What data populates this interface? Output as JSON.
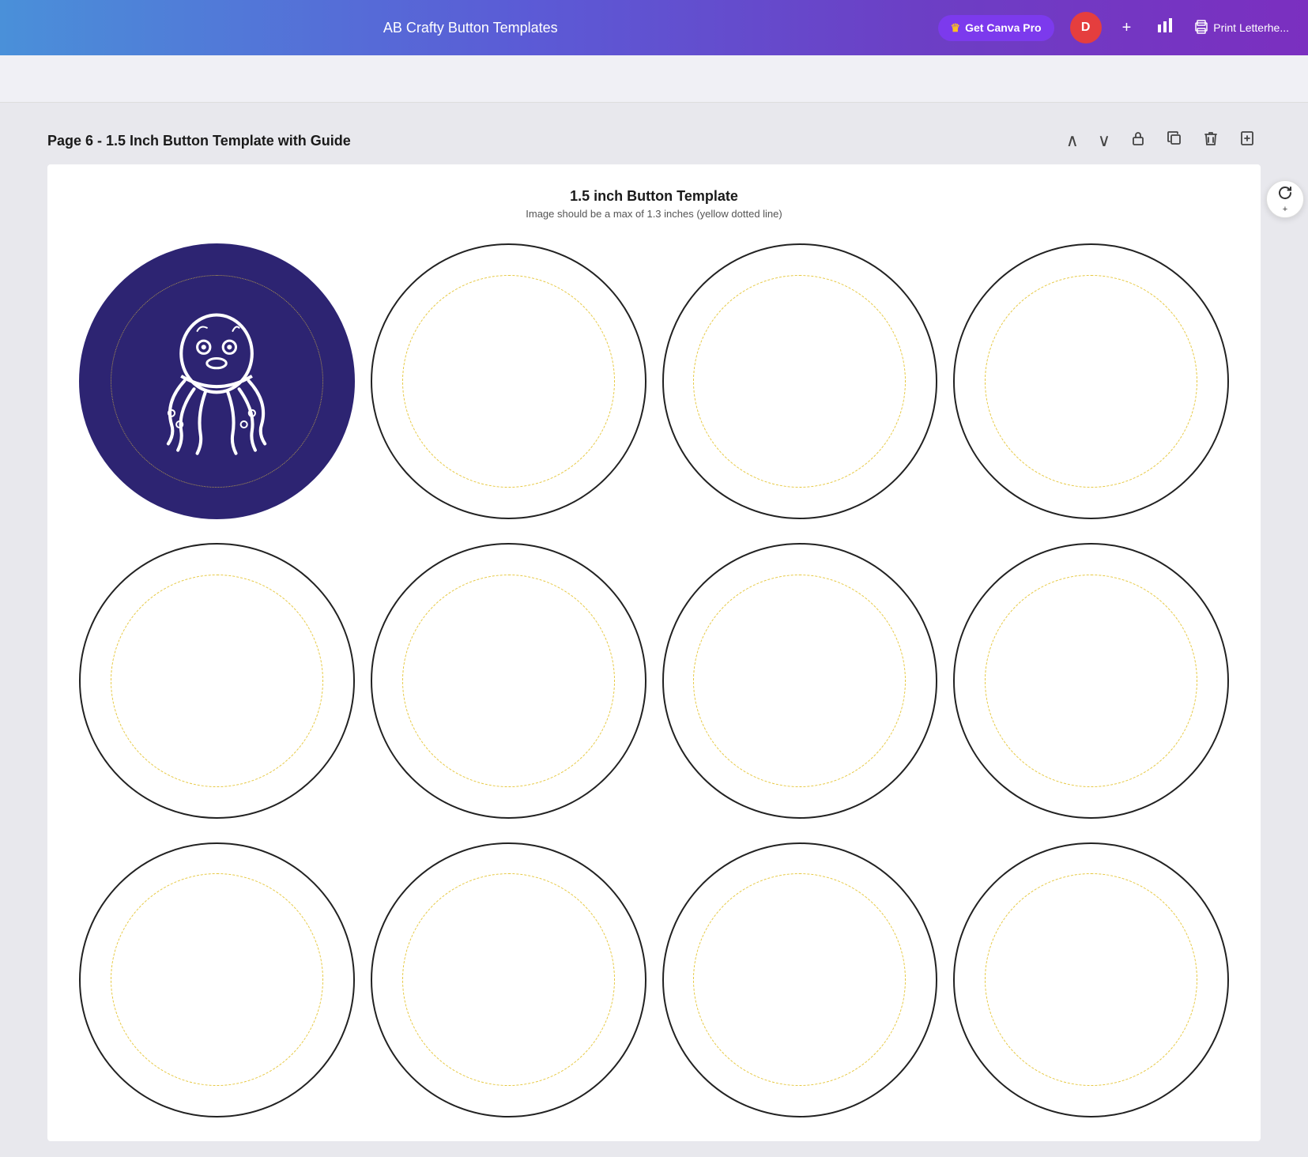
{
  "navbar": {
    "title": "AB Crafty Button Templates",
    "canva_pro_label": "Get Canva Pro",
    "avatar_letter": "D",
    "print_label": "Print Letterhe..."
  },
  "page_section": {
    "title": "Page 6 - 1.5 Inch Button Template with Guide"
  },
  "document": {
    "title": "1.5 inch Button Template",
    "subtitle": "Image should be a max of 1.3 inches (yellow dotted line)"
  },
  "icons": {
    "crown": "♛",
    "plus": "+",
    "chart": "📊",
    "print_doc": "📄",
    "chevron_up": "∧",
    "chevron_down": "∨",
    "lock": "🔒",
    "copy": "⧉",
    "trash": "🗑",
    "add_page": "✚",
    "refresh": "↺"
  }
}
